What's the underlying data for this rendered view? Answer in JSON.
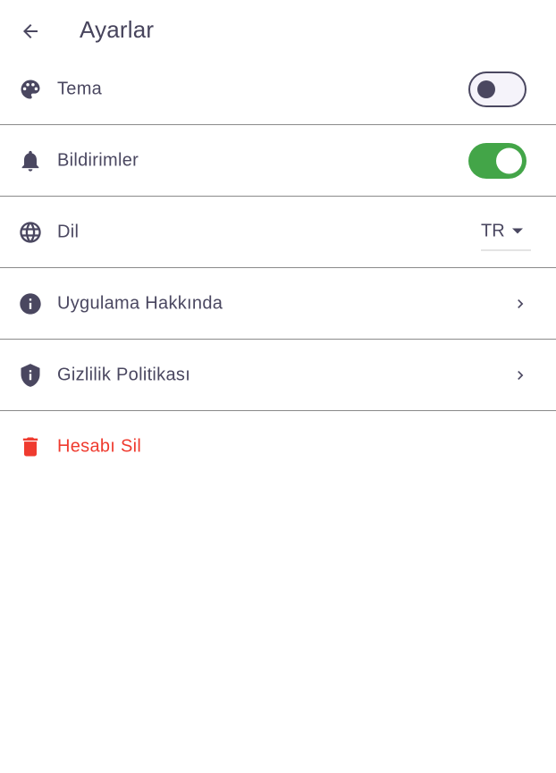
{
  "header": {
    "title": "Ayarlar",
    "back_icon": "arrow-back-icon"
  },
  "settings": {
    "theme": {
      "label": "Tema",
      "icon": "palette-icon",
      "toggle_on": false
    },
    "notifications": {
      "label": "Bildirimler",
      "icon": "bell-icon",
      "toggle_on": true
    },
    "language": {
      "label": "Dil",
      "icon": "globe-icon",
      "value": "TR"
    },
    "about": {
      "label": "Uygulama Hakkında",
      "icon": "info-icon"
    },
    "privacy": {
      "label": "Gizlilik Politikası",
      "icon": "shield-icon"
    },
    "delete_account": {
      "label": "Hesabı Sil",
      "icon": "trash-icon"
    }
  },
  "colors": {
    "text": "#4a4760",
    "toggle_on": "#43a548",
    "danger": "#ef3b2f",
    "divider": "#8a8a8a"
  }
}
